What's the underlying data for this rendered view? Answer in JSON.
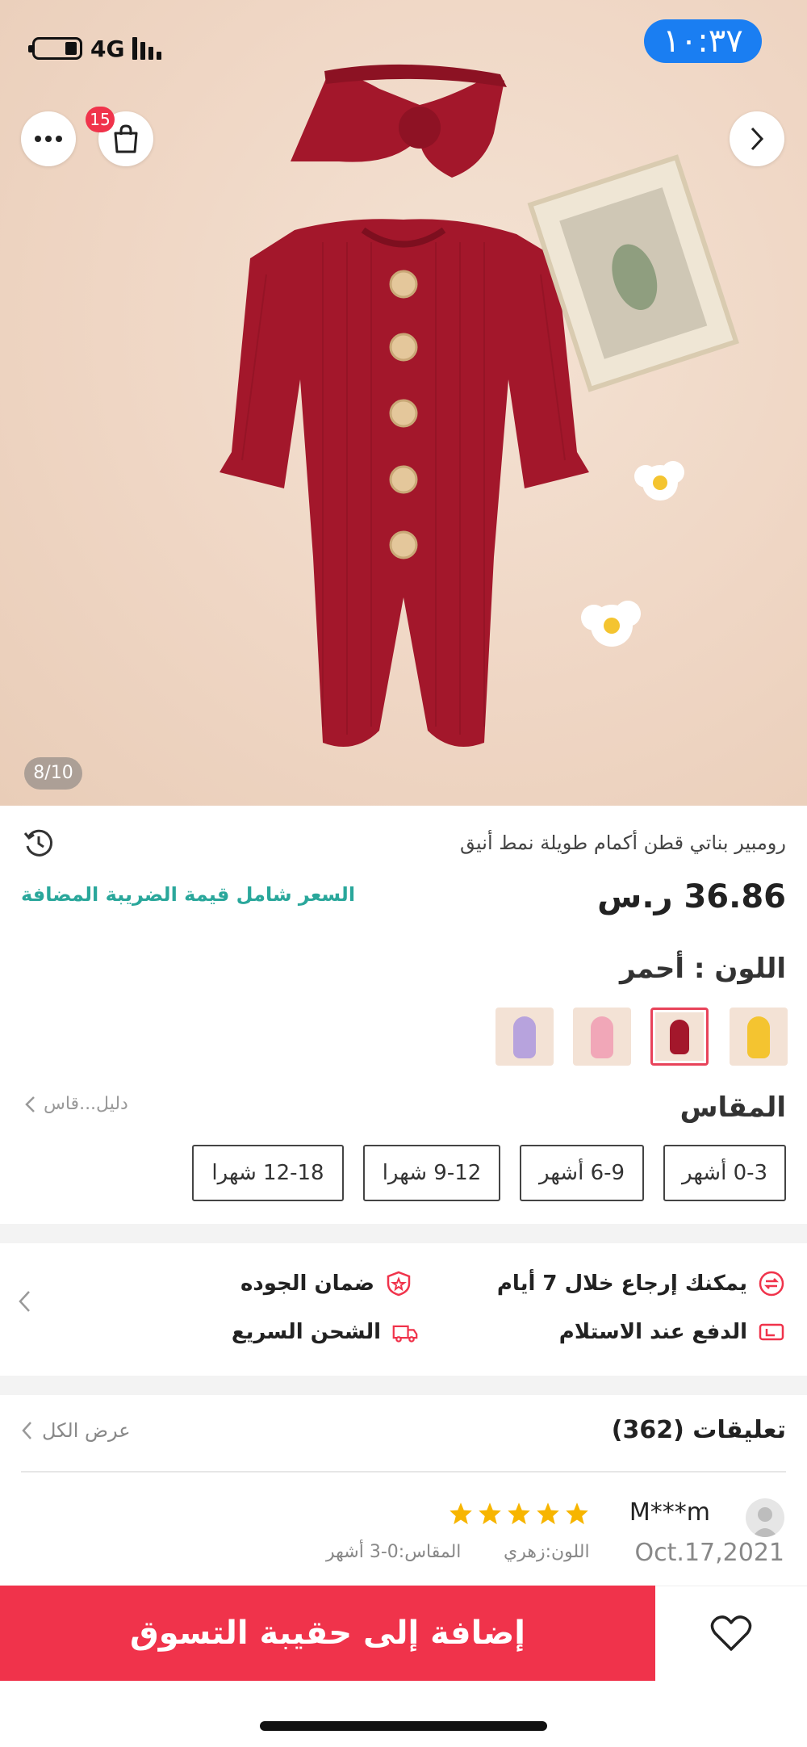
{
  "status_bar": {
    "time": "١٠:٣٧",
    "network": "4G"
  },
  "gallery": {
    "counter": "8/10",
    "cart_badge": "15"
  },
  "product": {
    "title": "رومبير بناتي قطن أكمام طويلة نمط أنيق",
    "price": "36.86 ر.س",
    "vat_note": "السعر شامل قيمة الضريبة المضافة",
    "color_label": "اللون : أحمر",
    "swatches": [
      {
        "name": "yellow",
        "color": "#f4c430"
      },
      {
        "name": "red",
        "color": "#a3172b"
      },
      {
        "name": "pink",
        "color": "#f1a7b8"
      },
      {
        "name": "purple",
        "color": "#b7a3dd"
      }
    ],
    "size_label": "المقاس",
    "size_guide": "دليل...قاس",
    "sizes": [
      "0-3 أشهر",
      "6-9 أشهر",
      "9-12 شهرا",
      "12-18 شهرا"
    ]
  },
  "features": {
    "return": "يمكنك إرجاع خلال 7 أيام",
    "quality": "ضمان الجوده",
    "cod": "الدفع عند الاستلام",
    "shipping": "الشحن السريع"
  },
  "reviews": {
    "title": "تعليقات (362)",
    "view_all": "عرض الكل",
    "first": {
      "user": "M***m",
      "date": "Oct.17,2021",
      "rating": 5,
      "color": "اللون:زهري",
      "size": "المقاس:0-3 أشهر"
    }
  },
  "actions": {
    "add_to_bag": "إضافة إلى حقيبة التسوق"
  },
  "colors": {
    "accent": "#f0334b",
    "teal": "#2aa79b",
    "time_pill": "#1a7ef2",
    "romper": "#a3172b"
  }
}
